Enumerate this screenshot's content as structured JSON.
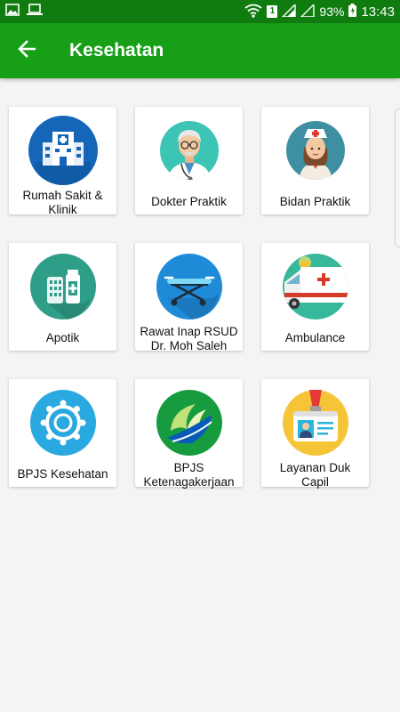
{
  "status_bar": {
    "battery": "93%",
    "time": "13:43",
    "sim_badge": "1",
    "icons": [
      "image-icon",
      "laptop-icon",
      "wifi-icon",
      "sim-icon",
      "signal-icon",
      "no-signal-icon",
      "battery-icon"
    ]
  },
  "app_bar": {
    "title": "Kesehatan",
    "back_icon": "arrow-left-icon"
  },
  "colors": {
    "status_bar": "#107c10",
    "app_bar": "#17a017",
    "background": "#f4f4f4"
  },
  "tiles": [
    {
      "label": "Rumah Sakit &\nKlinik",
      "icon": "hospital-icon"
    },
    {
      "label": "Dokter Praktik",
      "icon": "doctor-icon"
    },
    {
      "label": "Bidan Praktik",
      "icon": "midwife-icon"
    },
    {
      "label": "Apotik",
      "icon": "pharmacy-icon"
    },
    {
      "label": "Rawat Inap RSUD\nDr. Moh Saleh",
      "icon": "stretcher-icon"
    },
    {
      "label": "Ambulance",
      "icon": "ambulance-icon"
    },
    {
      "label": "BPJS Kesehatan",
      "icon": "bpjs-kesehatan-icon"
    },
    {
      "label": "BPJS\nKetenagakerjaan",
      "icon": "bpjs-ketenagakerjaan-icon"
    },
    {
      "label": "Layanan Duk Capil",
      "icon": "id-card-icon"
    }
  ]
}
